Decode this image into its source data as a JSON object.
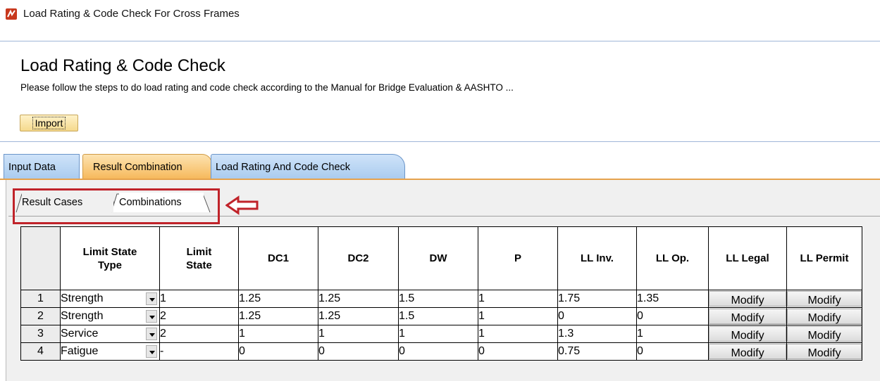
{
  "window": {
    "title": "Load Rating & Code Check For Cross Frames",
    "icon": "app-logo-icon"
  },
  "header": {
    "heading": "Load Rating & Code Check",
    "instructions": "Please follow the steps to do load rating and code check according to the Manual for Bridge Evaluation & AASHTO  ..."
  },
  "toolbar": {
    "import_label": "Import"
  },
  "main_tabs": [
    {
      "label": "Input Data",
      "active": false
    },
    {
      "label": "Result Combination",
      "active": true
    },
    {
      "label": "Load Rating And Code Check",
      "active": false
    }
  ],
  "sub_tabs": [
    {
      "label": "Result Cases",
      "active": false
    },
    {
      "label": "Combinations",
      "active": true
    }
  ],
  "annotation": {
    "highlight_color": "#c0232a",
    "arrow_icon": "left-arrow-icon"
  },
  "table": {
    "headers": {
      "limit_state_type": "Limit State Type",
      "limit_state": "Limit State",
      "dc1": "DC1",
      "dc2": "DC2",
      "dw": "DW",
      "p": "P",
      "ll_inv": "LL Inv.",
      "ll_op": "LL Op.",
      "ll_legal": "LL Legal",
      "ll_permit": "LL Permit"
    },
    "rows": [
      {
        "index": "1",
        "type": "Strength",
        "state": "1",
        "dc1": "1.25",
        "dc2": "1.25",
        "dw": "1.5",
        "p": "1",
        "ll_inv": "1.75",
        "ll_op": "1.35",
        "legal": "Modify",
        "permit": "Modify"
      },
      {
        "index": "2",
        "type": "Strength",
        "state": "2",
        "dc1": "1.25",
        "dc2": "1.25",
        "dw": "1.5",
        "p": "1",
        "ll_inv": "0",
        "ll_op": "0",
        "legal": "Modify",
        "permit": "Modify"
      },
      {
        "index": "3",
        "type": "Service",
        "state": "2",
        "dc1": "1",
        "dc2": "1",
        "dw": "1",
        "p": "1",
        "ll_inv": "1.3",
        "ll_op": "1",
        "legal": "Modify",
        "permit": "Modify"
      },
      {
        "index": "4",
        "type": "Fatigue",
        "state": "-",
        "dc1": "0",
        "dc2": "0",
        "dw": "0",
        "p": "0",
        "ll_inv": "0.75",
        "ll_op": "0",
        "legal": "Modify",
        "permit": "Modify"
      }
    ]
  },
  "colors": {
    "active_tab": "#f6b85a",
    "inactive_tab": "#a9cbee",
    "annotation_red": "#c0232a"
  }
}
